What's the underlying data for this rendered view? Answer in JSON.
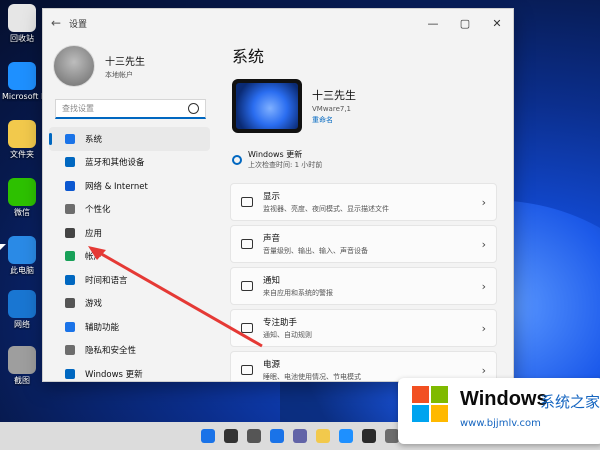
{
  "desktop": {
    "icons": [
      {
        "label": "回收站",
        "color": "#e6e6e6"
      },
      {
        "label": "Microsoft Edge",
        "color": "#1e90ff"
      },
      {
        "label": "文件夹",
        "color": "#f2c94c"
      },
      {
        "label": "微信",
        "color": "#2dc100"
      },
      {
        "label": "此电脑",
        "color": "#2a8ae6"
      },
      {
        "label": "网络",
        "color": "#1976d2"
      },
      {
        "label": "截图",
        "color": "#9e9e9e"
      }
    ]
  },
  "window": {
    "title": "设置",
    "controls": [
      "—",
      "▢",
      "✕"
    ]
  },
  "profile": {
    "name": "十三先生",
    "account": "本地帐户"
  },
  "search": {
    "placeholder": "查找设置"
  },
  "nav": [
    {
      "label": "系统",
      "icon": "monitor-icon",
      "color": "#1a73e8",
      "active": true
    },
    {
      "label": "蓝牙和其他设备",
      "icon": "bluetooth-icon",
      "color": "#0067c0"
    },
    {
      "label": "网络 & Internet",
      "icon": "wifi-icon",
      "color": "#0b57d0"
    },
    {
      "label": "个性化",
      "icon": "brush-icon",
      "color": "#6d6d6d"
    },
    {
      "label": "应用",
      "icon": "apps-icon",
      "color": "#444444"
    },
    {
      "label": "帐户",
      "icon": "user-icon",
      "color": "#18a058"
    },
    {
      "label": "时间和语言",
      "icon": "globe-icon",
      "color": "#0067c0"
    },
    {
      "label": "游戏",
      "icon": "gamepad-icon",
      "color": "#555555"
    },
    {
      "label": "辅助功能",
      "icon": "accessibility-icon",
      "color": "#1a73e8"
    },
    {
      "label": "隐私和安全性",
      "icon": "shield-icon",
      "color": "#6d6d6d"
    },
    {
      "label": "Windows 更新",
      "icon": "update-icon",
      "color": "#0067c0"
    }
  ],
  "main": {
    "title": "系统",
    "device": {
      "name": "十三先生",
      "model": "VMware7,1",
      "rename": "重命名"
    },
    "update": {
      "title": "Windows 更新",
      "sub": "上次检查时间: 1 小时前"
    },
    "cards": [
      {
        "title": "显示",
        "sub": "监视器、亮度、夜间模式、显示描述文件",
        "icon": "display-icon"
      },
      {
        "title": "声音",
        "sub": "音量级别、输出、输入、声音设备",
        "icon": "sound-icon"
      },
      {
        "title": "通知",
        "sub": "来自应用和系统的警报",
        "icon": "bell-icon"
      },
      {
        "title": "专注助手",
        "sub": "通知、自动规则",
        "icon": "moon-icon"
      },
      {
        "title": "电源",
        "sub": "睡眠、电池使用情况、节电模式",
        "icon": "power-icon"
      }
    ]
  },
  "taskbar": {
    "items": [
      {
        "icon": "start-icon",
        "color": "#1a73e8"
      },
      {
        "icon": "search-icon",
        "color": "#333333"
      },
      {
        "icon": "taskview-icon",
        "color": "#555555"
      },
      {
        "icon": "widgets-icon",
        "color": "#1a73e8"
      },
      {
        "icon": "chat-icon",
        "color": "#6264a7"
      },
      {
        "icon": "explorer-icon",
        "color": "#f2c94c"
      },
      {
        "icon": "edge-icon",
        "color": "#1e90ff"
      },
      {
        "icon": "store-icon",
        "color": "#2b2b2b"
      },
      {
        "icon": "settings-icon",
        "color": "#6d6d6d"
      }
    ]
  },
  "watermark": {
    "brand": "Windows",
    "brand_cn": "系统之家",
    "url": "www.bjjmlv.com"
  }
}
